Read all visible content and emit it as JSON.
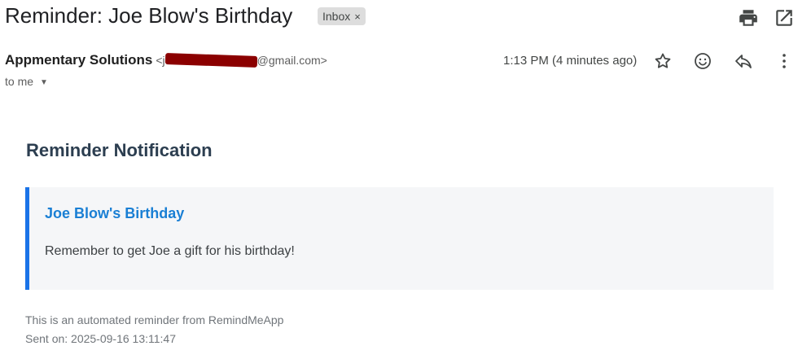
{
  "email": {
    "subject": "Reminder: Joe Blow's Birthday",
    "label_chip": "Inbox",
    "label_chip_remove": "×",
    "sender_name": "Appmentary Solutions",
    "sender_email_prefix": "<j",
    "sender_email_suffix": "@gmail.com>",
    "recipient": "to me",
    "time": "1:13 PM (4 minutes ago)"
  },
  "body": {
    "heading": "Reminder Notification",
    "reminder_title": "Joe Blow's Birthday",
    "reminder_message": "Remember to get Joe a gift for his birthday!",
    "footer_line1": "This is an automated reminder from RemindMeApp",
    "footer_line2": "Sent on: 2025-09-16 13:11:47"
  },
  "icons": {
    "print": "print-icon",
    "open_new_window": "open-in-new-icon",
    "star": "star-icon",
    "emoji": "emoji-icon",
    "reply": "reply-icon",
    "more": "more-vert-icon",
    "recipient_details": "caret-down-icon"
  },
  "colors": {
    "accent_border": "#1a73e8",
    "reminder_title": "#1a7fd4",
    "heading": "#2c3e50",
    "redaction": "#8b0000"
  }
}
